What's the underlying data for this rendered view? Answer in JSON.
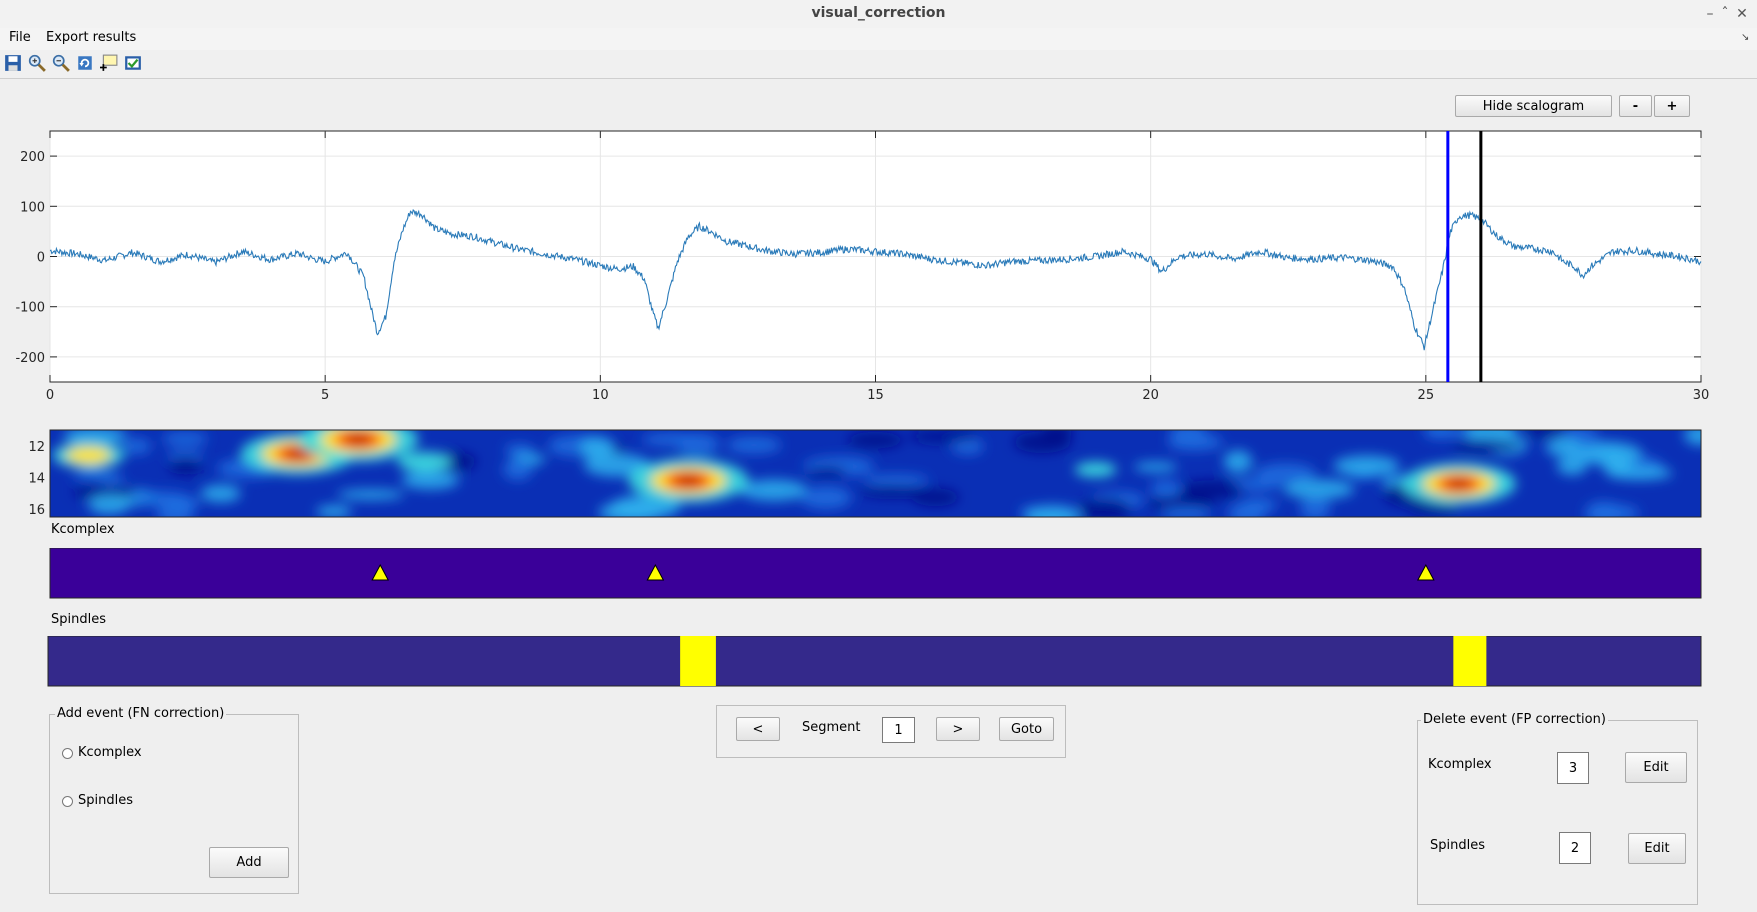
{
  "window": {
    "title": "visual_correction"
  },
  "menu": {
    "file": "File",
    "export": "Export results"
  },
  "toolbar": {
    "items": [
      "save-icon",
      "zoom-in-icon",
      "zoom-out-icon",
      "rotate-icon",
      "data-cursor-icon",
      "insert-icon"
    ]
  },
  "controls": {
    "hide_scalogram": "Hide scalogram",
    "minus": "-",
    "plus": "+"
  },
  "chart_data": [
    {
      "type": "line",
      "name": "signal",
      "xlim": [
        0,
        30
      ],
      "ylim": [
        -250,
        250
      ],
      "x_ticks": [
        "0",
        "5",
        "10",
        "15",
        "20",
        "25",
        "30"
      ],
      "y_ticks": [
        "200",
        "100",
        "0",
        "-100",
        "-200"
      ],
      "grid": true,
      "color": "#2b7bb9",
      "points": [
        [
          0,
          12
        ],
        [
          0.5,
          5
        ],
        [
          1,
          -8
        ],
        [
          1.5,
          8
        ],
        [
          2,
          -10
        ],
        [
          2.5,
          4
        ],
        [
          3,
          -12
        ],
        [
          3.5,
          10
        ],
        [
          4,
          -6
        ],
        [
          4.5,
          6
        ],
        [
          4.8,
          -5
        ],
        [
          5,
          -10
        ],
        [
          5.4,
          8
        ],
        [
          5.7,
          -40
        ],
        [
          5.85,
          -110
        ],
        [
          5.95,
          -152
        ],
        [
          6.1,
          -120
        ],
        [
          6.25,
          -10
        ],
        [
          6.4,
          50
        ],
        [
          6.55,
          90
        ],
        [
          6.75,
          85
        ],
        [
          7.0,
          55
        ],
        [
          7.3,
          45
        ],
        [
          7.7,
          40
        ],
        [
          8,
          30
        ],
        [
          8.5,
          15
        ],
        [
          9,
          5
        ],
        [
          9.5,
          -5
        ],
        [
          10,
          -18
        ],
        [
          10.3,
          -25
        ],
        [
          10.6,
          -20
        ],
        [
          10.8,
          -45
        ],
        [
          10.95,
          -110
        ],
        [
          11.05,
          -143
        ],
        [
          11.2,
          -90
        ],
        [
          11.4,
          -10
        ],
        [
          11.6,
          40
        ],
        [
          11.8,
          60
        ],
        [
          12.0,
          50
        ],
        [
          12.3,
          30
        ],
        [
          12.7,
          20
        ],
        [
          13,
          12
        ],
        [
          13.5,
          5
        ],
        [
          14,
          8
        ],
        [
          14.5,
          15
        ],
        [
          15,
          10
        ],
        [
          15.5,
          5
        ],
        [
          16,
          -5
        ],
        [
          16.5,
          -12
        ],
        [
          17,
          -18
        ],
        [
          17.5,
          -10
        ],
        [
          18,
          -8
        ],
        [
          18.5,
          -5
        ],
        [
          19,
          0
        ],
        [
          19.5,
          10
        ],
        [
          20,
          -5
        ],
        [
          20.2,
          -30
        ],
        [
          20.5,
          0
        ],
        [
          21,
          5
        ],
        [
          21.5,
          -5
        ],
        [
          22,
          10
        ],
        [
          22.5,
          -3
        ],
        [
          23,
          -5
        ],
        [
          23.5,
          -2
        ],
        [
          24,
          -8
        ],
        [
          24.4,
          -20
        ],
        [
          24.6,
          -60
        ],
        [
          24.8,
          -140
        ],
        [
          24.97,
          -180
        ],
        [
          25.1,
          -120
        ],
        [
          25.3,
          -30
        ],
        [
          25.45,
          50
        ],
        [
          25.6,
          80
        ],
        [
          25.8,
          82
        ],
        [
          26.0,
          75
        ],
        [
          26.3,
          40
        ],
        [
          26.6,
          20
        ],
        [
          27,
          15
        ],
        [
          27.3,
          10
        ],
        [
          27.5,
          -10
        ],
        [
          27.7,
          -20
        ],
        [
          27.85,
          -38
        ],
        [
          28,
          -20
        ],
        [
          28.4,
          10
        ],
        [
          28.8,
          12
        ],
        [
          29.2,
          5
        ],
        [
          29.6,
          0
        ],
        [
          30,
          -10
        ]
      ],
      "cursors": [
        {
          "x": 25.4,
          "color": "#0000ff"
        },
        {
          "x": 26.0,
          "color": "#000000"
        }
      ]
    },
    {
      "type": "heatmap",
      "name": "scalogram",
      "y_ticks": [
        "12",
        "14",
        "16"
      ],
      "colormap": "jet",
      "hotspots": [
        {
          "x": 0.7,
          "y": 12.6,
          "intensity": 0.6
        },
        {
          "x": 4.5,
          "y": 12.5,
          "intensity": 0.95
        },
        {
          "x": 5.6,
          "y": 11.6,
          "intensity": 1.0
        },
        {
          "x": 11.6,
          "y": 14.2,
          "intensity": 1.0
        },
        {
          "x": 25.6,
          "y": 14.4,
          "intensity": 0.95
        },
        {
          "x": 6.8,
          "y": 13.0,
          "intensity": 0.45
        },
        {
          "x": 19.0,
          "y": 13.5,
          "intensity": 0.35
        }
      ]
    },
    {
      "type": "scatter",
      "name": "Kcomplex",
      "title": "Kcomplex",
      "background": "#3a0099",
      "marker_color": "#ffff00",
      "events": [
        6.0,
        11.0,
        25.0
      ]
    },
    {
      "type": "bar",
      "name": "Spindles",
      "title": "Spindles",
      "background": "#34298b",
      "bar_color": "#ffff00",
      "intervals": [
        [
          11.45,
          12.1
        ],
        [
          25.5,
          26.1
        ]
      ]
    }
  ],
  "add_panel": {
    "title": "Add event (FN correction)",
    "option_kcomplex": "Kcomplex",
    "option_spindles": "Spindles",
    "add_button": "Add"
  },
  "nav": {
    "prev": "<",
    "segment_label": "Segment",
    "segment_value": "1",
    "next": ">",
    "goto": "Goto"
  },
  "delete_panel": {
    "title": "Delete event (FP correction)",
    "kcomplex_label": "Kcomplex",
    "kcomplex_value": "3",
    "spindles_label": "Spindles",
    "spindles_value": "2",
    "edit_label": "Edit"
  }
}
